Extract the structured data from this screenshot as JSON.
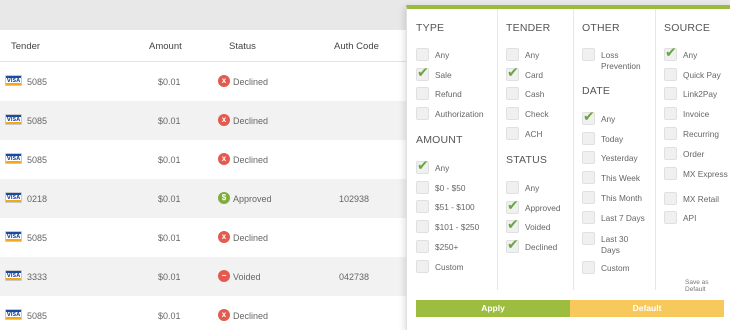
{
  "table": {
    "headers": {
      "tender": "Tender",
      "amount": "Amount",
      "status": "Status",
      "auth_code": "Auth Code"
    },
    "rows": [
      {
        "card": "VISA",
        "number": "5085",
        "amount": "$0.01",
        "status": "Declined",
        "status_icon": "x",
        "auth": ""
      },
      {
        "card": "VISA",
        "number": "5085",
        "amount": "$0.01",
        "status": "Declined",
        "status_icon": "x",
        "auth": ""
      },
      {
        "card": "VISA",
        "number": "5085",
        "amount": "$0.01",
        "status": "Declined",
        "status_icon": "x",
        "auth": ""
      },
      {
        "card": "VISA",
        "number": "0218",
        "amount": "$0.01",
        "status": "Approved",
        "status_icon": "$",
        "auth": "102938"
      },
      {
        "card": "VISA",
        "number": "5085",
        "amount": "$0.01",
        "status": "Declined",
        "status_icon": "x",
        "auth": ""
      },
      {
        "card": "VISA",
        "number": "3333",
        "amount": "$0.01",
        "status": "Voided",
        "status_icon": "−",
        "auth": "042738"
      },
      {
        "card": "VISA",
        "number": "5085",
        "amount": "$0.01",
        "status": "Declined",
        "status_icon": "x",
        "auth": ""
      }
    ]
  },
  "filter": {
    "type": {
      "title": "TYPE",
      "options": [
        {
          "label": "Any",
          "checked": false
        },
        {
          "label": "Sale",
          "checked": true
        },
        {
          "label": "Refund",
          "checked": false
        },
        {
          "label": "Authorization",
          "checked": false
        }
      ]
    },
    "amount": {
      "title": "AMOUNT",
      "options": [
        {
          "label": "Any",
          "checked": true
        },
        {
          "label": "$0 - $50",
          "checked": false
        },
        {
          "label": "$51 - $100",
          "checked": false
        },
        {
          "label": "$101 - $250",
          "checked": false
        },
        {
          "label": "$250+",
          "checked": false
        },
        {
          "label": "Custom",
          "checked": false
        }
      ]
    },
    "tender": {
      "title": "TENDER",
      "options": [
        {
          "label": "Any",
          "checked": false
        },
        {
          "label": "Card",
          "checked": true
        },
        {
          "label": "Cash",
          "checked": false
        },
        {
          "label": "Check",
          "checked": false
        },
        {
          "label": "ACH",
          "checked": false
        }
      ]
    },
    "status": {
      "title": "STATUS",
      "options": [
        {
          "label": "Any",
          "checked": false
        },
        {
          "label": "Approved",
          "checked": true
        },
        {
          "label": "Voided",
          "checked": true
        },
        {
          "label": "Declined",
          "checked": true
        }
      ]
    },
    "other": {
      "title": "OTHER",
      "options": [
        {
          "label": "Loss Prevention",
          "checked": false
        }
      ]
    },
    "date": {
      "title": "DATE",
      "options": [
        {
          "label": "Any",
          "checked": true
        },
        {
          "label": "Today",
          "checked": false
        },
        {
          "label": "Yesterday",
          "checked": false
        },
        {
          "label": "This Week",
          "checked": false
        },
        {
          "label": "This Month",
          "checked": false
        },
        {
          "label": "Last 7 Days",
          "checked": false
        },
        {
          "label": "Last 30 Days",
          "checked": false
        },
        {
          "label": "Custom",
          "checked": false
        }
      ]
    },
    "source": {
      "title": "SOURCE",
      "options": [
        {
          "label": "Any",
          "checked": true
        },
        {
          "label": "Quick Pay",
          "checked": false
        },
        {
          "label": "Link2Pay",
          "checked": false
        },
        {
          "label": "Invoice",
          "checked": false
        },
        {
          "label": "Recurring",
          "checked": false
        },
        {
          "label": "Order",
          "checked": false
        },
        {
          "label": "MX Express",
          "checked": false
        },
        {
          "label": "MX Retail",
          "checked": false
        },
        {
          "label": "API",
          "checked": false
        }
      ]
    },
    "save_default_label": "Save as Default",
    "apply_label": "Apply",
    "default_label": "Default"
  },
  "colors": {
    "accent_green": "#9cbd3f",
    "accent_yellow": "#f7c95d",
    "declined_red": "#e35b4f",
    "approved_green": "#7fae3c"
  }
}
